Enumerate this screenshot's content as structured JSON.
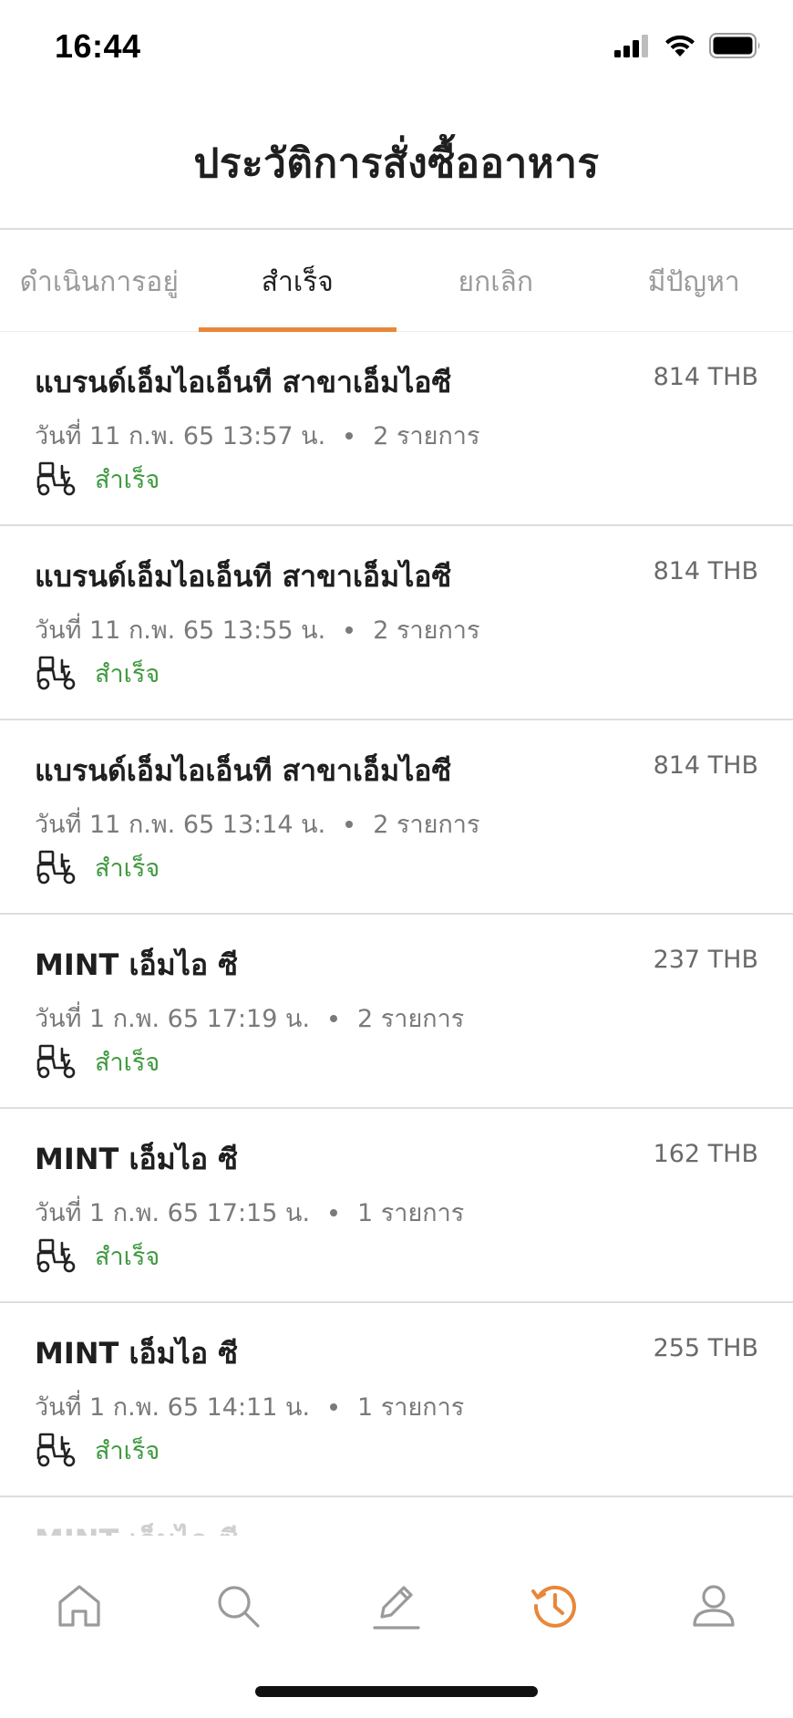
{
  "status_bar": {
    "time": "16:44"
  },
  "header": {
    "title": "ประวัติการสั่งซื้ออาหาร"
  },
  "tabs": [
    {
      "label": "ดำเนินการอยู่",
      "active": false
    },
    {
      "label": "สำเร็จ",
      "active": true
    },
    {
      "label": "ยกเลิก",
      "active": false
    },
    {
      "label": "มีปัญหา",
      "active": false
    }
  ],
  "orders": [
    {
      "name": "แบรนด์เอ็มไอเอ็นที สาขาเอ็มไอซี",
      "price": "814 THB",
      "date": "วันที่ 11 ก.พ. 65 13:57 น.",
      "items": "2 รายการ",
      "status": "สำเร็จ"
    },
    {
      "name": "แบรนด์เอ็มไอเอ็นที สาขาเอ็มไอซี",
      "price": "814 THB",
      "date": "วันที่ 11 ก.พ. 65 13:55 น.",
      "items": "2 รายการ",
      "status": "สำเร็จ"
    },
    {
      "name": "แบรนด์เอ็มไอเอ็นที สาขาเอ็มไอซี",
      "price": "814 THB",
      "date": "วันที่ 11 ก.พ. 65 13:14 น.",
      "items": "2 รายการ",
      "status": "สำเร็จ"
    },
    {
      "name": "MINT เอ็มไอ ซี",
      "price": "237 THB",
      "date": "วันที่ 1 ก.พ. 65 17:19 น.",
      "items": "2 รายการ",
      "status": "สำเร็จ"
    },
    {
      "name": "MINT เอ็มไอ ซี",
      "price": "162 THB",
      "date": "วันที่ 1 ก.พ. 65 17:15 น.",
      "items": "1 รายการ",
      "status": "สำเร็จ"
    },
    {
      "name": "MINT เอ็มไอ ซี",
      "price": "255 THB",
      "date": "วันที่ 1 ก.พ. 65 14:11 น.",
      "items": "1 รายการ",
      "status": "สำเร็จ"
    }
  ],
  "partial_order": {
    "name": "MINT เอ็มไอ ซี"
  },
  "icons": {
    "delivery": "delivery-scooter-icon",
    "nav": [
      "home-icon",
      "search-icon",
      "edit-icon",
      "history-icon",
      "profile-icon"
    ]
  },
  "bottom_nav": {
    "active": "history"
  },
  "colors": {
    "accent": "#e8873a",
    "success": "#3f9a3f",
    "muted": "#9a9a9a",
    "divider": "#dedede"
  }
}
